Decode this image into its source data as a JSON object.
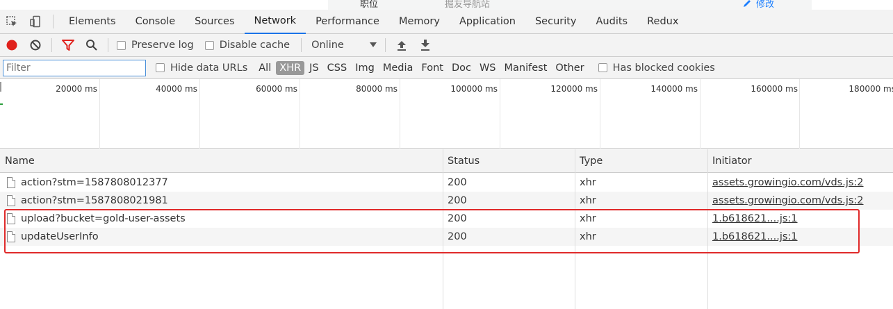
{
  "page_behind": {
    "left_text": "职位",
    "right_text": "掘友导航站",
    "edit_label": "修改"
  },
  "tabs": [
    "Elements",
    "Console",
    "Sources",
    "Network",
    "Performance",
    "Memory",
    "Application",
    "Security",
    "Audits",
    "Redux"
  ],
  "active_tab": "Network",
  "toolbar": {
    "preserve_log": "Preserve log",
    "disable_cache": "Disable cache",
    "throttling": "Online"
  },
  "filterbar": {
    "placeholder": "Filter",
    "hide_data_urls": "Hide data URLs",
    "types": [
      "All",
      "XHR",
      "JS",
      "CSS",
      "Img",
      "Media",
      "Font",
      "Doc",
      "WS",
      "Manifest",
      "Other"
    ],
    "selected_type": "XHR",
    "has_blocked_cookies": "Has blocked cookies"
  },
  "timeline": {
    "ticks": [
      "20000 ms",
      "40000 ms",
      "60000 ms",
      "80000 ms",
      "100000 ms",
      "120000 ms",
      "140000 ms",
      "160000 ms",
      "180000 ms"
    ]
  },
  "table": {
    "columns": [
      "Name",
      "Status",
      "Type",
      "Initiator"
    ],
    "rows": [
      {
        "name": "action?stm=1587808012377",
        "status": "200",
        "type": "xhr",
        "initiator": "assets.growingio.com/vds.js:2"
      },
      {
        "name": "action?stm=1587808021981",
        "status": "200",
        "type": "xhr",
        "initiator": "assets.growingio.com/vds.js:2"
      },
      {
        "name": "upload?bucket=gold-user-assets",
        "status": "200",
        "type": "xhr",
        "initiator": "1.b618621....js:1"
      },
      {
        "name": "updateUserInfo",
        "status": "200",
        "type": "xhr",
        "initiator": "1.b618621....js:1"
      }
    ]
  },
  "colors": {
    "record": "#e0211c",
    "filter_icon": "#e0211c",
    "active_tab_underline": "#1a73e8",
    "highlight_box": "#e02a2a"
  }
}
